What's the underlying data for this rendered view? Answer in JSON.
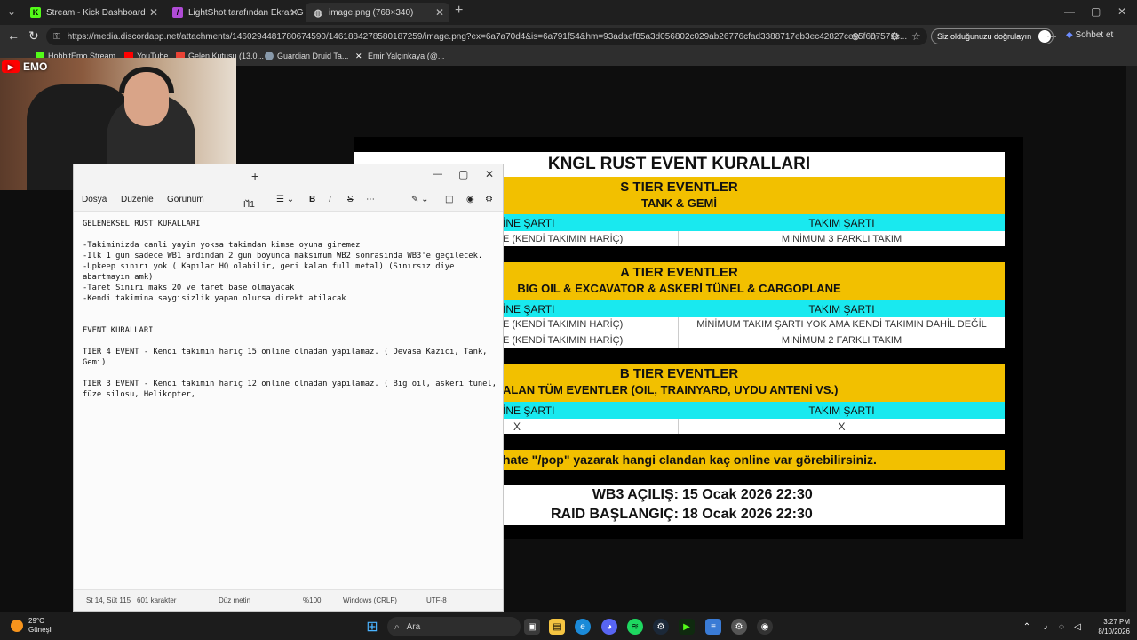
{
  "browser": {
    "tabs": [
      {
        "label": "Stream - Kick Dashboard",
        "active": false
      },
      {
        "label": "LightShot tarafından Ekran Görün",
        "active": false
      },
      {
        "label": "image.png (768×340)",
        "active": true
      }
    ],
    "url": "https://media.discordapp.net/attachments/1460294481780674590/1461884278580187259/image.png?ex=6a7a70d4&is=6a791f54&hm=93adaef85a3d056802c029ab26776cfad3388717eb3ec42827ce95f687571c...",
    "verify_label": "Siz olduğunuzu doğrulayın",
    "chat_label": "Sohbet et",
    "bookmarks": [
      "HobbitEmo Stream",
      "YouTube",
      "Gelen Kutusu (13.0...",
      "Guardian Druid Ta...",
      "Emir Yalçınkaya (@..."
    ]
  },
  "webcam": {
    "channel_label": "EMO"
  },
  "event_image": {
    "title": "KNGL RUST EVENT KURALLARI",
    "s_tier": {
      "heading": "S TIER EVENTLER",
      "sub": "TANK & GEMİ",
      "col_left": "İNE ŞARTI",
      "col_right": "TAKIM ŞARTI",
      "rows": [
        [
          "E (KENDİ TAKIMIN HARİÇ)",
          "MİNİMUM 3 FARKLI TAKIM"
        ]
      ]
    },
    "a_tier": {
      "heading": "A TIER EVENTLER",
      "sub": "BIG OIL & EXCAVATOR & ASKERİ TÜNEL & CARGOPLANE",
      "col_left": "İNE ŞARTI",
      "col_right": "TAKIM ŞARTI",
      "rows": [
        [
          "E (KENDİ TAKIMIN HARİÇ)",
          "MİNİMUM TAKIM ŞARTI YOK AMA KENDİ TAKIMIN DAHİL DEĞİL"
        ],
        [
          "E (KENDİ TAKIMIN HARİÇ)",
          "MİNİMUM 2 FARKLI TAKIM"
        ]
      ]
    },
    "b_tier": {
      "heading": "B TIER EVENTLER",
      "sub": "ALAN TÜM EVENTLER (OIL, TRAINYARD, UYDU ANTENİ VS.)",
      "col_left": "İNE ŞARTI",
      "col_right": "TAKIM ŞARTI",
      "rows": [
        [
          "X",
          "X"
        ]
      ]
    },
    "pop_note": "hate \"/pop\" yazarak hangi clandan kaç online var görebilirsiniz.",
    "wb3_label": "WB3 AÇILIŞ:",
    "wb3_value": "15 Ocak 2026 22:30",
    "raid_label": "RAID BAŞLANGIÇ:",
    "raid_value": "18 Ocak 2026 22:30"
  },
  "notepad": {
    "menu": [
      "Dosya",
      "Düzenle",
      "Görünüm"
    ],
    "heading_btn": "H1",
    "lines": [
      "GELENEKSEL RUST KURALLARI",
      "",
      "-Takiminizda canli yayin yoksa takimdan kimse oyuna giremez",
      "-Ilk 1 gün sadece WB1 ardından 2 gün boyunca maksimum WB2 sonrasında WB3'e geçilecek.",
      "-Upkeep sınırı yok ( Kapılar HQ olabilir, geri kalan full metal) (Sınırsız diye",
      "abartmayın amk)",
      "-Taret Sınırı maks 20 ve taret base olmayacak",
      "-Kendi takimina saygisizlik yapan olursa direkt atilacak",
      "",
      "",
      "EVENT KURALLARI",
      "",
      "TIER 4 EVENT - Kendi takımın hariç 15 online olmadan yapılamaz. ( Devasa Kazıcı, Tank,",
      "Gemi)",
      "",
      "TIER 3 EVENT - Kendi takımın hariç 12 online olmadan yapılamaz. ( Big oil, askeri tünel,",
      "füze silosu, Helikopter,"
    ],
    "status": {
      "position": "St 14, Süt 115",
      "chars": "601 karakter",
      "mode": "Düz metin",
      "zoom": "%100",
      "eol": "Windows (CRLF)",
      "encoding": "UTF-8"
    }
  },
  "taskbar": {
    "weather_temp": "29°C",
    "weather_desc": "Güneşli",
    "search_placeholder": "Ara",
    "time": "3:27 PM",
    "date": "8/10/2026"
  },
  "colors": {
    "gold": "#f2c000",
    "cyan": "#19e9ef"
  }
}
